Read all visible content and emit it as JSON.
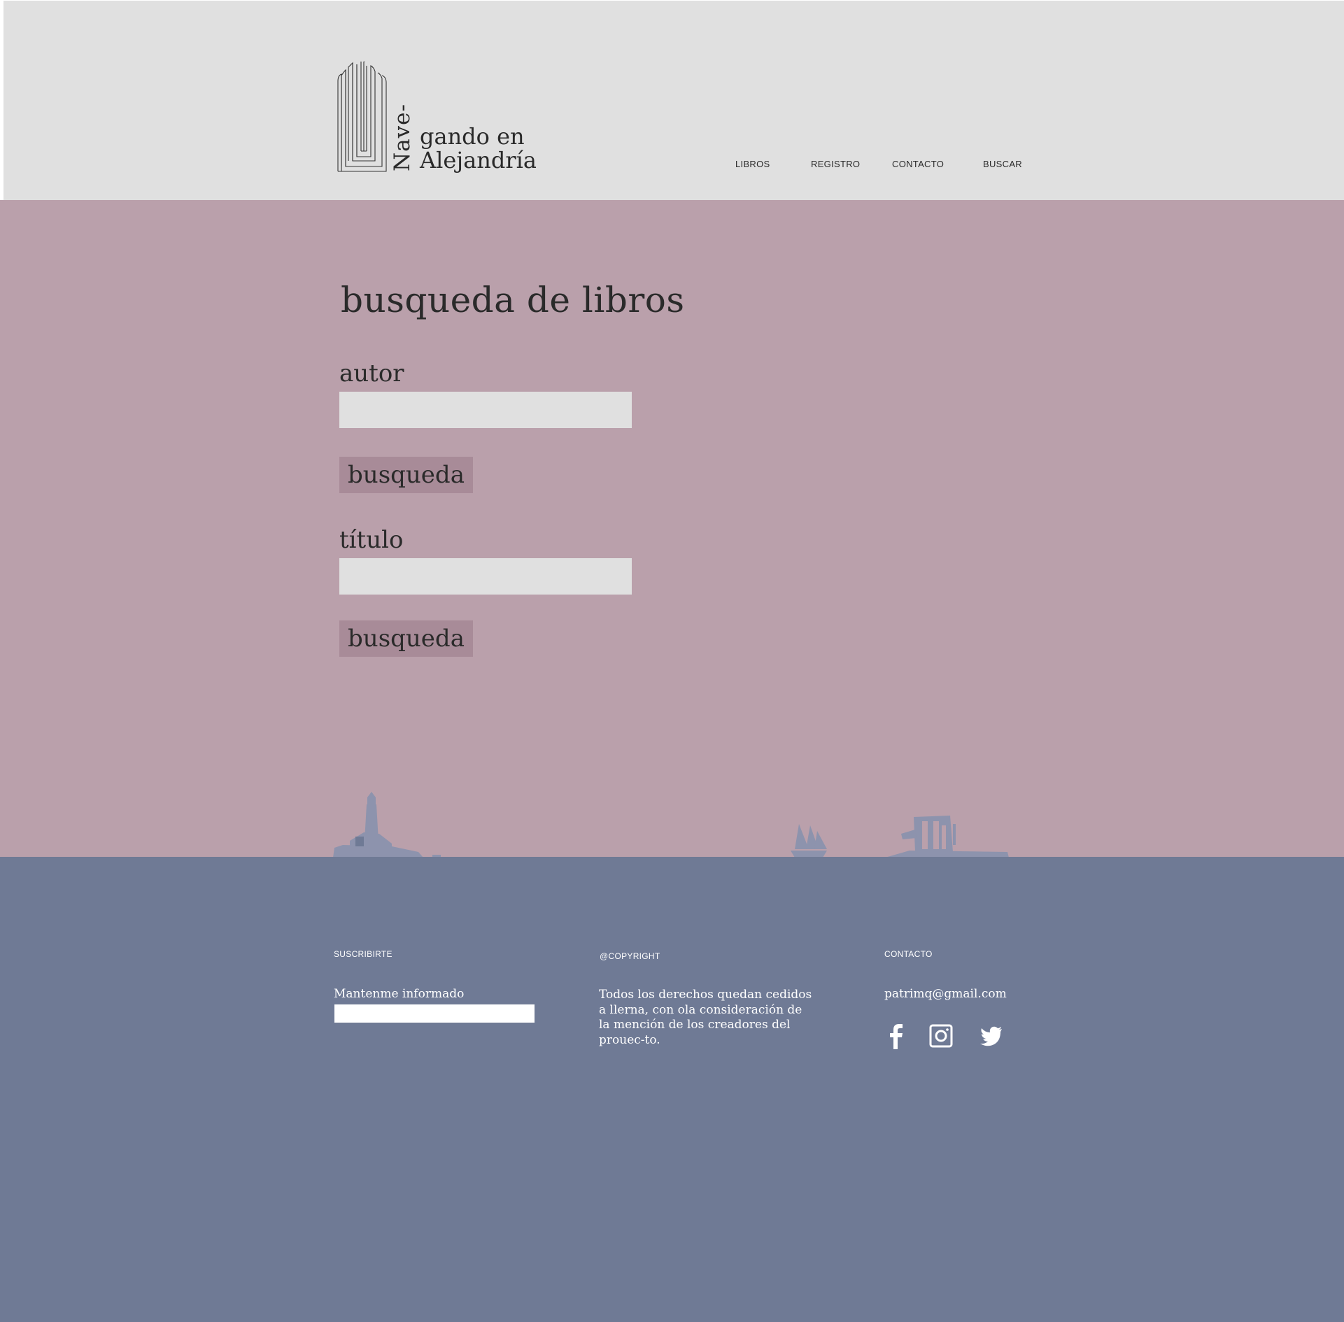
{
  "brand": {
    "vertical_word": "Nave-",
    "line1": "gando en",
    "line2": "Alejandría"
  },
  "nav": {
    "items": [
      "LIBROS",
      "REGISTRO",
      "CONTACTO",
      "BUSCAR"
    ]
  },
  "search": {
    "title": "busqueda de libros",
    "author_label": "autor",
    "author_value": "",
    "author_button": "busqueda",
    "title_label": "título",
    "title_value": "",
    "title_button": "busqueda"
  },
  "footer": {
    "subscribe": {
      "heading": "SUSCRIBIRTE",
      "label": "Mantenme informado",
      "value": ""
    },
    "copyright": {
      "heading": "@COPYRIGHT",
      "body": "Todos los derechos quedan cedidos a llerna, con ola consideración de la mención de los creadores del prouec-to."
    },
    "contact": {
      "heading": "CONTACTO",
      "email": "patrimq@gmail.com",
      "social_icons": [
        "facebook-icon",
        "instagram-icon",
        "twitter-icon"
      ]
    }
  },
  "colors": {
    "header_bg": "#e0e0e0",
    "main_bg": "#baa0ab",
    "button_bg": "#a88b98",
    "footer_bg": "#6f7a95",
    "text_dark": "#2a2a2a"
  }
}
